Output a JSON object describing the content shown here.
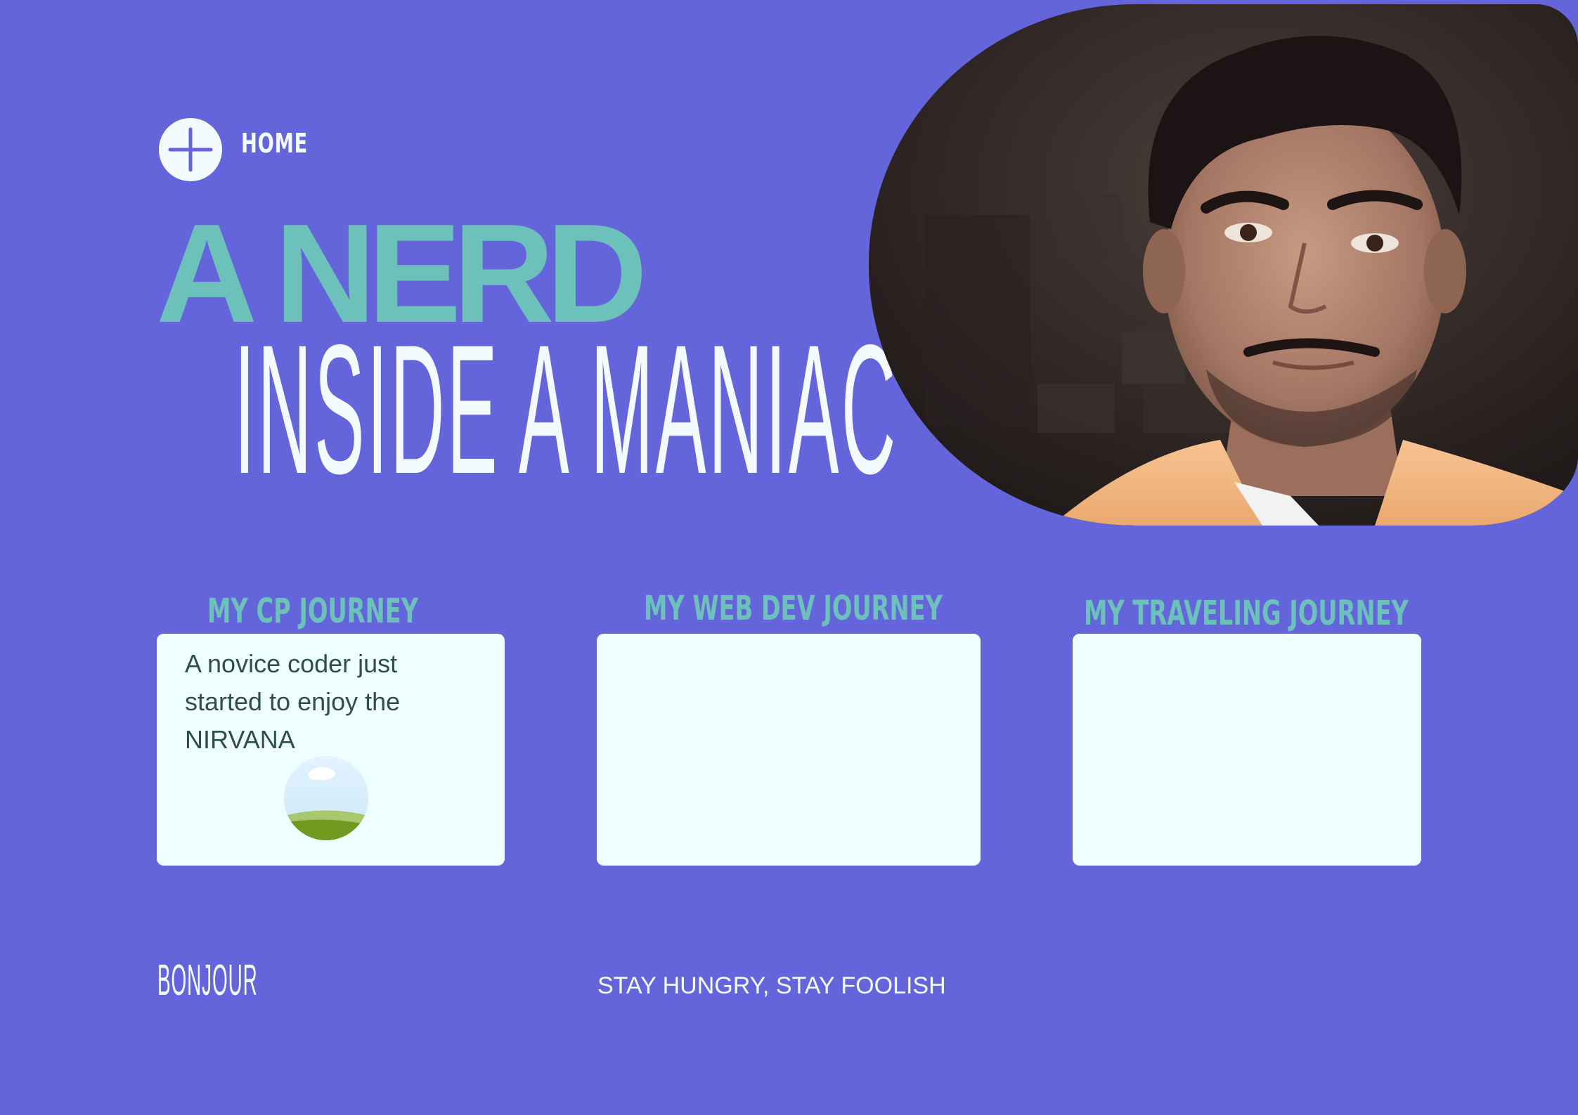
{
  "nav": {
    "home_label": "HOME",
    "home_icon": "plus-icon"
  },
  "hero": {
    "line1": "A NERD",
    "line2": "INSIDE A MANIAC",
    "photo_alt": "portrait photo"
  },
  "cards": [
    {
      "title": "MY CP JOURNEY",
      "text": "A novice coder just started to enjoy the NIRVANA"
    },
    {
      "title": "MY WEB DEV JOURNEY",
      "text": ""
    },
    {
      "title": "MY TRAVELING JOURNEY",
      "text": ""
    }
  ],
  "footer": {
    "left": "BONJOUR",
    "right": "STAY HUNGRY, STAY FOOLISH"
  },
  "colors": {
    "background": "#6565db",
    "accent_teal": "#6cc2bb",
    "text_light": "#f3fbff",
    "card_bg": "#efffff",
    "card_text": "#2f4f4c"
  }
}
